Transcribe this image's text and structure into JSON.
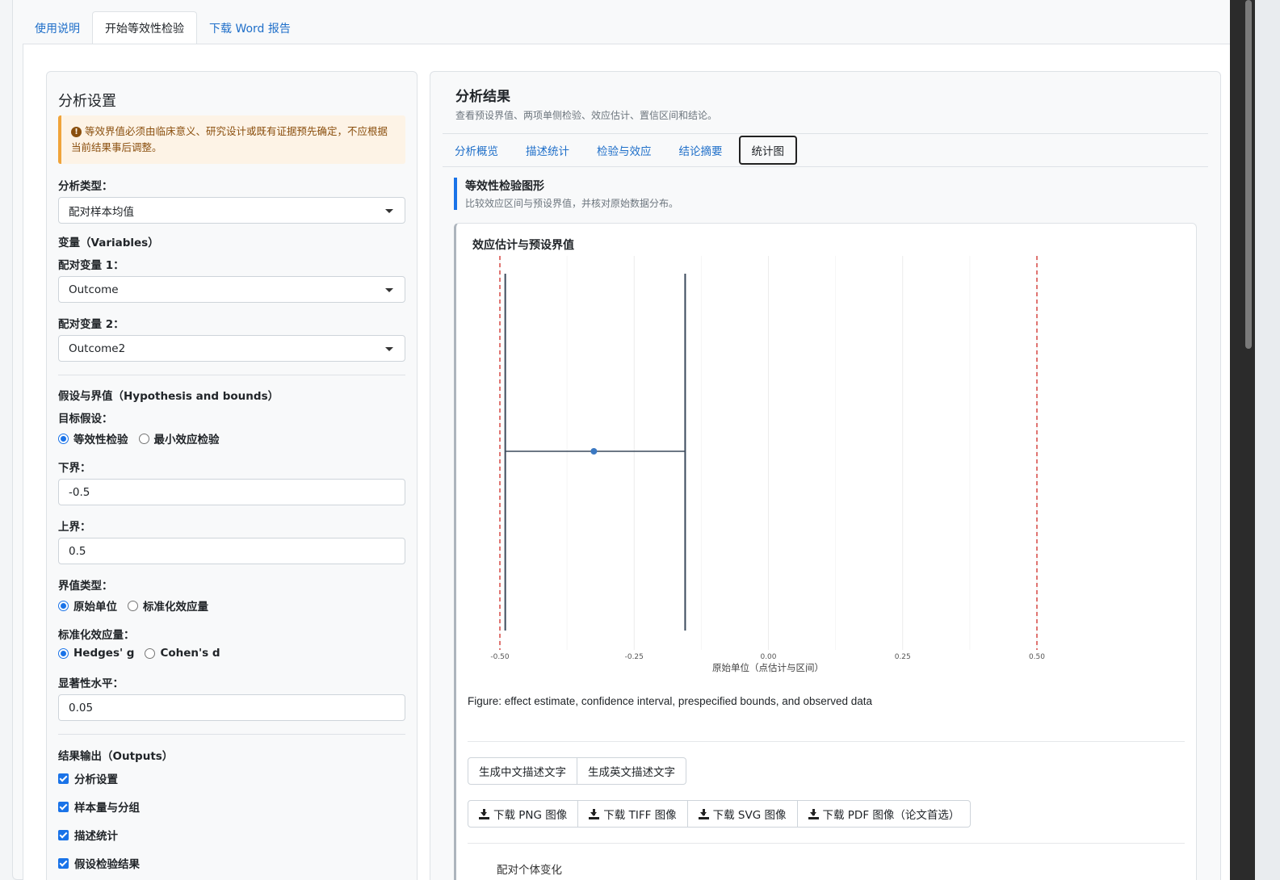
{
  "top_tabs": [
    "使用说明",
    "开始等效性检验",
    "下载 Word 报告"
  ],
  "settings": {
    "title": "分析设置",
    "warning": "等效界值必须由临床意义、研究设计或既有证据预先确定，不应根据当前结果事后调整。",
    "analysis_type_label": "分析类型：",
    "analysis_type_value": "配对样本均值",
    "variables_heading": "变量（Variables）",
    "var1_label": "配对变量 1：",
    "var1_value": "Outcome",
    "var2_label": "配对变量 2：",
    "var2_value": "Outcome2",
    "hyp_heading": "假设与界值（Hypothesis and bounds）",
    "target_label": "目标假设：",
    "target_options": [
      "等效性检验",
      "最小效应检验"
    ],
    "lower_label": "下界：",
    "lower_value": "-0.5",
    "upper_label": "上界：",
    "upper_value": "0.5",
    "bound_type_label": "界值类型：",
    "bound_type_options": [
      "原始单位",
      "标准化效应量"
    ],
    "std_effect_label": "标准化效应量：",
    "std_effect_options": [
      "Hedges' g",
      "Cohen's d"
    ],
    "alpha_label": "显著性水平：",
    "alpha_value": "0.05",
    "outputs_heading": "结果输出（Outputs）",
    "outputs": [
      "分析设置",
      "样本量与分组",
      "描述统计",
      "假设检验结果"
    ]
  },
  "results": {
    "title": "分析结果",
    "subtitle": "查看预设界值、两项单侧检验、效应估计、置信区间和结论。",
    "tabs": [
      "分析概览",
      "描述统计",
      "检验与效应",
      "结论摘要",
      "统计图"
    ],
    "figure_heading": "等效性检验图形",
    "figure_subheading": "比较效应区间与预设界值，并核对原始数据分布。",
    "caption": "Figure: effect estimate, confidence interval, prespecified bounds, and observed data",
    "describe_buttons": [
      "生成中文描述文字",
      "生成英文描述文字"
    ],
    "download_buttons": [
      "下载 PNG 图像",
      "下载 TIFF 图像",
      "下载 SVG 图像",
      "下载 PDF 图像（论文首选）"
    ],
    "next_plot_title": "配对个体变化"
  },
  "chart_data": {
    "type": "scatter",
    "title": "效应估计与预设界值",
    "xlabel": "原始单位（点估计与区间）",
    "ylabel": "",
    "xlim": [
      -0.5,
      0.5
    ],
    "x_ticks": [
      "-0.50",
      "-0.25",
      "0.00",
      "0.25",
      "0.50"
    ],
    "x_tick_values": [
      -0.5,
      -0.25,
      0,
      0.25,
      0.5
    ],
    "estimate": -0.325,
    "ci_lower": -0.49,
    "ci_upper": -0.155,
    "bounds": [
      -0.5,
      0.5
    ],
    "grid": true,
    "colors": {
      "bounds": "#d9534f",
      "interval": "#3b4a5c",
      "point": "#3a78c2"
    }
  }
}
